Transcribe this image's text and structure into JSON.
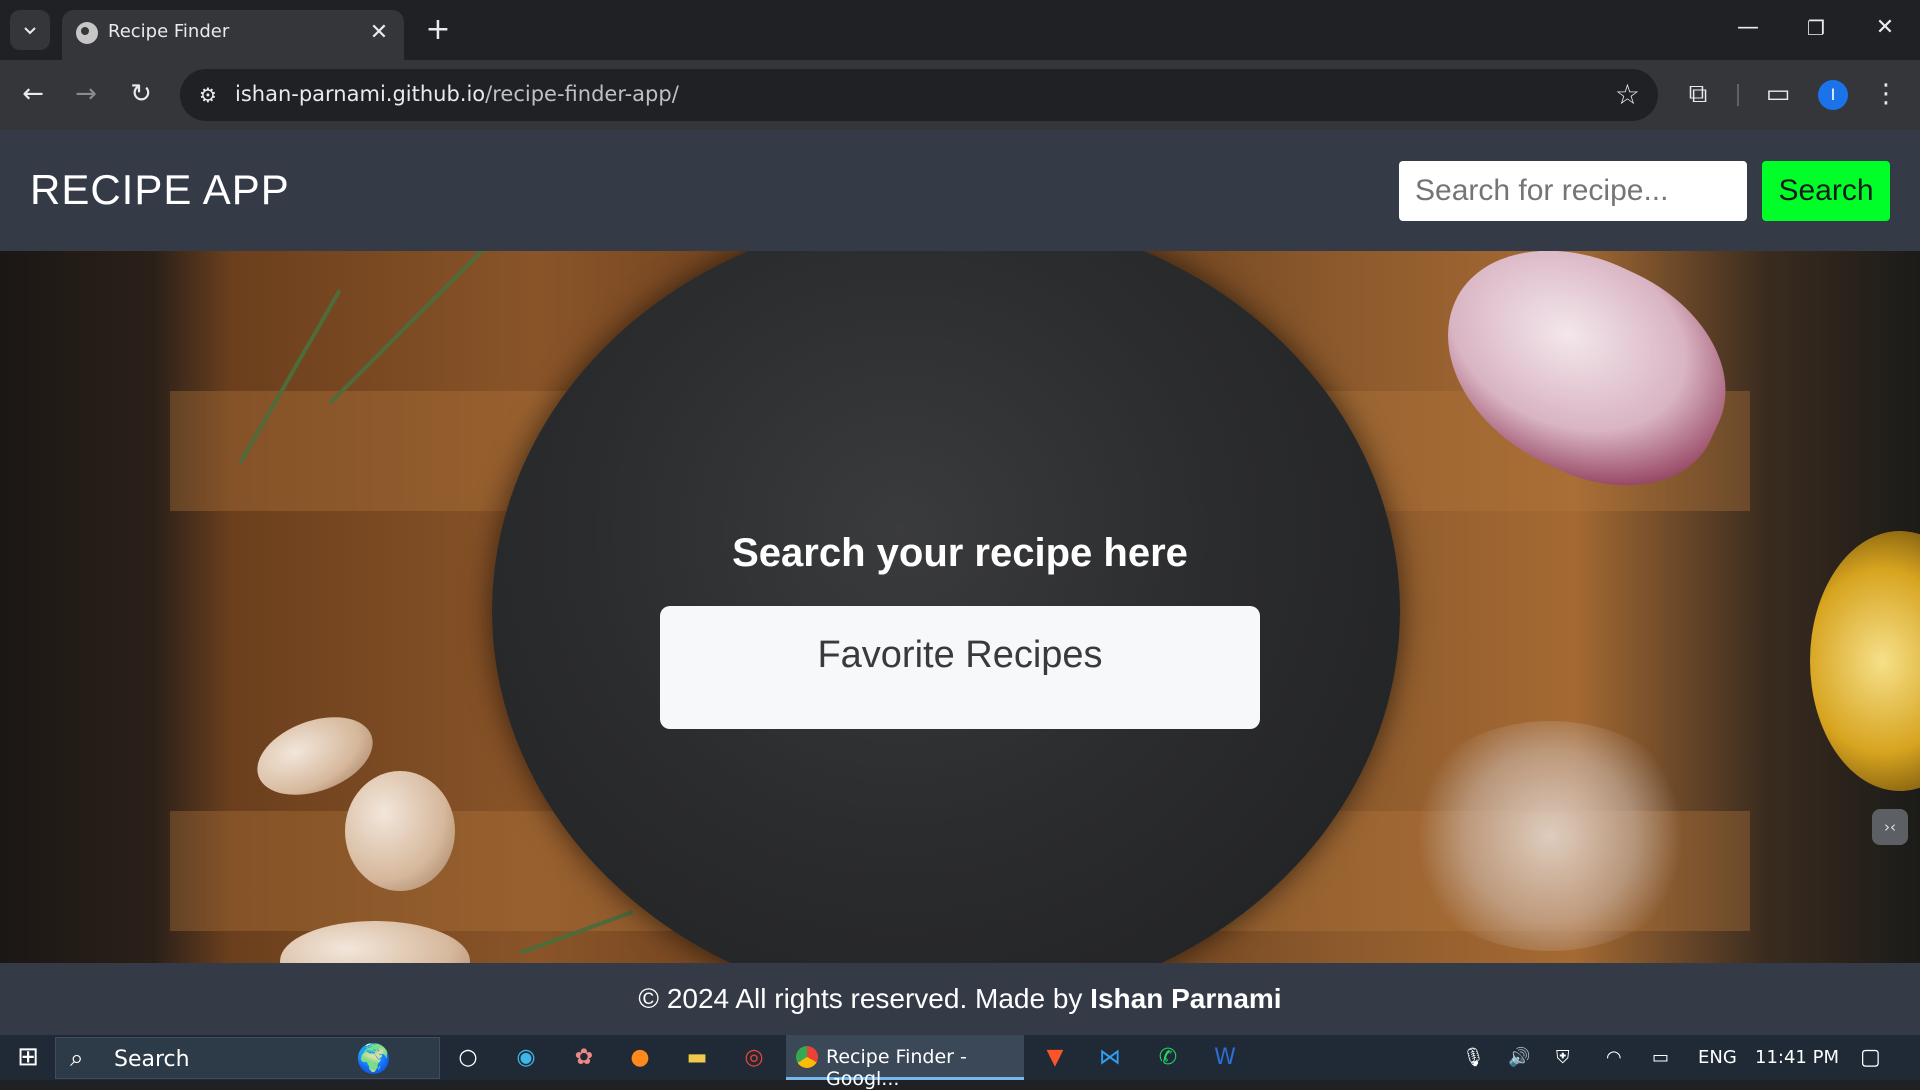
{
  "browser": {
    "tab_title": "Recipe Finder",
    "url_host": "ishan-parnami.github.io",
    "url_path": "/recipe-finder-app/",
    "profile_initial": "I",
    "icons": {
      "tab_search": "chevron-down-icon",
      "tab_close": "close-icon",
      "new_tab": "plus-icon",
      "back": "arrow-left-icon",
      "forward": "arrow-right-icon",
      "reload": "reload-icon",
      "site_info": "tune-icon",
      "bookmark": "star-icon",
      "extensions": "puzzle-icon",
      "cast": "cast-icon",
      "menu": "kebab-menu-icon"
    }
  },
  "window_controls": {
    "minimize": "—",
    "restore": "❐",
    "close": "✕"
  },
  "header": {
    "logo": "RECIPE APP",
    "search_placeholder": "Search for recipe...",
    "search_button": "Search"
  },
  "hero": {
    "title": "Search your recipe here",
    "favorites_button": "Favorite Recipes"
  },
  "footer": {
    "prefix": "© 2024 All rights reserved. Made by ",
    "author": "Ishan Parnami"
  },
  "taskbar": {
    "search_label": "Search",
    "active_app_label": "Recipe Finder - Googl...",
    "language": "ENG",
    "time": "11:41 PM"
  },
  "colors": {
    "header_bg": "#343a46",
    "search_button_bg": "#00ff29",
    "favorites_bg": "#f7f8fa",
    "chrome_dark": "#202124",
    "chrome_toolbar": "#35363a"
  }
}
